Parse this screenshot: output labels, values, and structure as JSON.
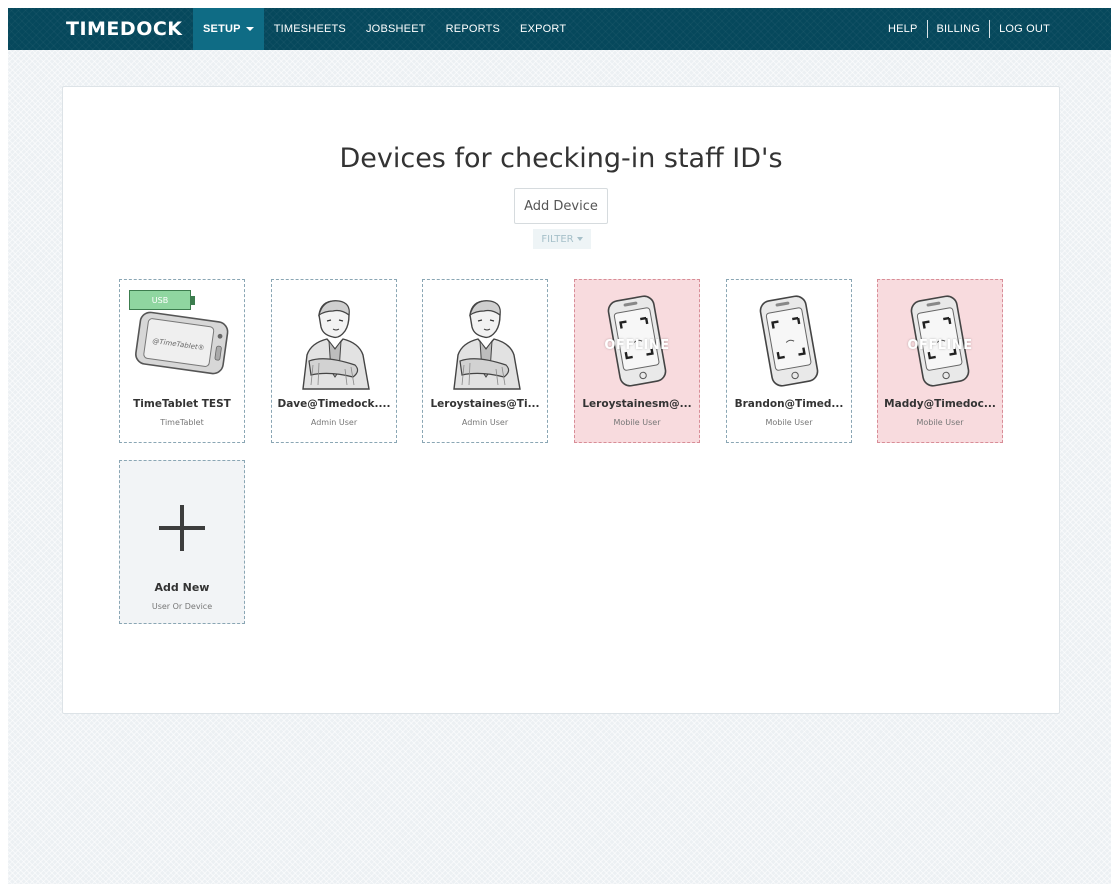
{
  "brand": {
    "logo": "TIMEDOCK"
  },
  "nav": {
    "left": [
      {
        "label": "SETUP",
        "active": true,
        "dropdown": true
      },
      {
        "label": "TIMESHEETS"
      },
      {
        "label": "JOBSHEET"
      },
      {
        "label": "REPORTS"
      },
      {
        "label": "EXPORT"
      }
    ],
    "right": [
      {
        "label": "HELP"
      },
      {
        "label": "BILLING"
      },
      {
        "label": "LOG OUT"
      }
    ]
  },
  "page": {
    "title": "Devices for checking-in staff ID's",
    "add_device_label": "Add Device",
    "filter_label": "FILTER"
  },
  "devices": [
    {
      "name": "TimeTablet TEST",
      "type": "TimeTablet",
      "badge": "USB",
      "image": "timetablet-device-icon",
      "status": "online"
    },
    {
      "name": "Dave@Timedock....",
      "type": "Admin User",
      "image": "admin-user-icon",
      "status": "online"
    },
    {
      "name": "Leroystaines@Ti...",
      "type": "Admin User",
      "image": "admin-user-icon",
      "status": "online"
    },
    {
      "name": "Leroystainesm@...",
      "type": "Mobile User",
      "image": "mobile-phone-icon",
      "status": "offline",
      "overlay": "OFFLINE"
    },
    {
      "name": "Brandon@Timed...",
      "type": "Mobile User",
      "image": "mobile-phone-icon",
      "status": "online"
    },
    {
      "name": "Maddy@Timedoc...",
      "type": "Mobile User",
      "image": "mobile-phone-icon",
      "status": "offline",
      "overlay": "OFFLINE"
    }
  ],
  "add_new": {
    "title": "Add New",
    "subtitle": "User Or Device",
    "icon": "plus-icon"
  },
  "colors": {
    "navbar": "#06485c",
    "nav_active": "#0f6c85",
    "offline_card": "#f8dbde",
    "usb_badge": "#8fd6a0",
    "add_new_card": "#f2f4f6"
  }
}
